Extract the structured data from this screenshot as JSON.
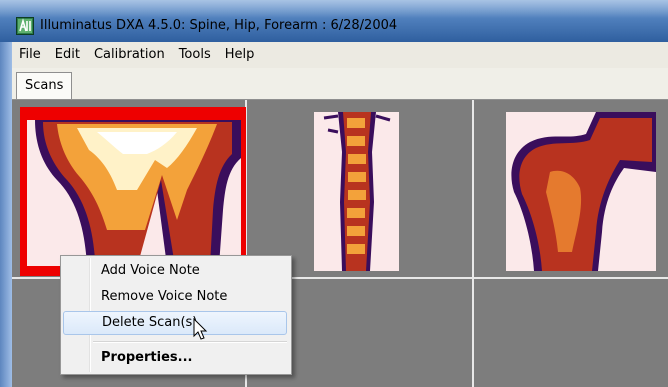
{
  "window": {
    "title": "Illuminatus DXA 4.5.0: Spine, Hip, Forearm : 6/28/2004",
    "icon": "app-icon"
  },
  "menubar": {
    "items": [
      "File",
      "Edit",
      "Calibration",
      "Tools",
      "Help"
    ]
  },
  "tabs": {
    "active": "Scans"
  },
  "scans": {
    "selected_index": 0,
    "thumbnails": [
      {
        "name": "scan-forearm-thumbnail",
        "selected": true
      },
      {
        "name": "scan-spine-thumbnail",
        "selected": false
      },
      {
        "name": "scan-hip-thumbnail",
        "selected": false
      }
    ]
  },
  "context_menu": {
    "items": [
      {
        "label": "Add Voice Note",
        "bold": false,
        "hover": false
      },
      {
        "label": "Remove Voice Note",
        "bold": false,
        "hover": false
      },
      {
        "label": "Delete Scan(s)",
        "bold": false,
        "hover": true
      },
      {
        "label": "Properties...",
        "bold": true,
        "hover": false
      }
    ]
  },
  "colors": {
    "selection": "#ee0000",
    "scan_background": "#fbe9ea",
    "bone_dark": "#3a0e5c",
    "bone_mid": "#b8331f",
    "bone_light": "#f3a23a"
  }
}
